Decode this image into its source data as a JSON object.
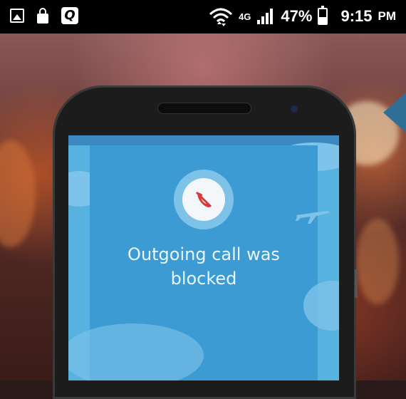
{
  "status_bar": {
    "left_icons": [
      "image-icon",
      "lock-icon",
      "q-app-icon"
    ],
    "q_label": "Q",
    "network": "4G",
    "battery_percent": "47%",
    "time": "9:15",
    "ampm": "PM"
  },
  "screen": {
    "message_line1": "Outgoing call was",
    "message_line2": "blocked",
    "icon": "blocked-call-icon"
  },
  "colors": {
    "screen_bg": "#57b2e0",
    "panel_bg": "#3d9bd4",
    "blocked_icon": "#d83b3b"
  }
}
